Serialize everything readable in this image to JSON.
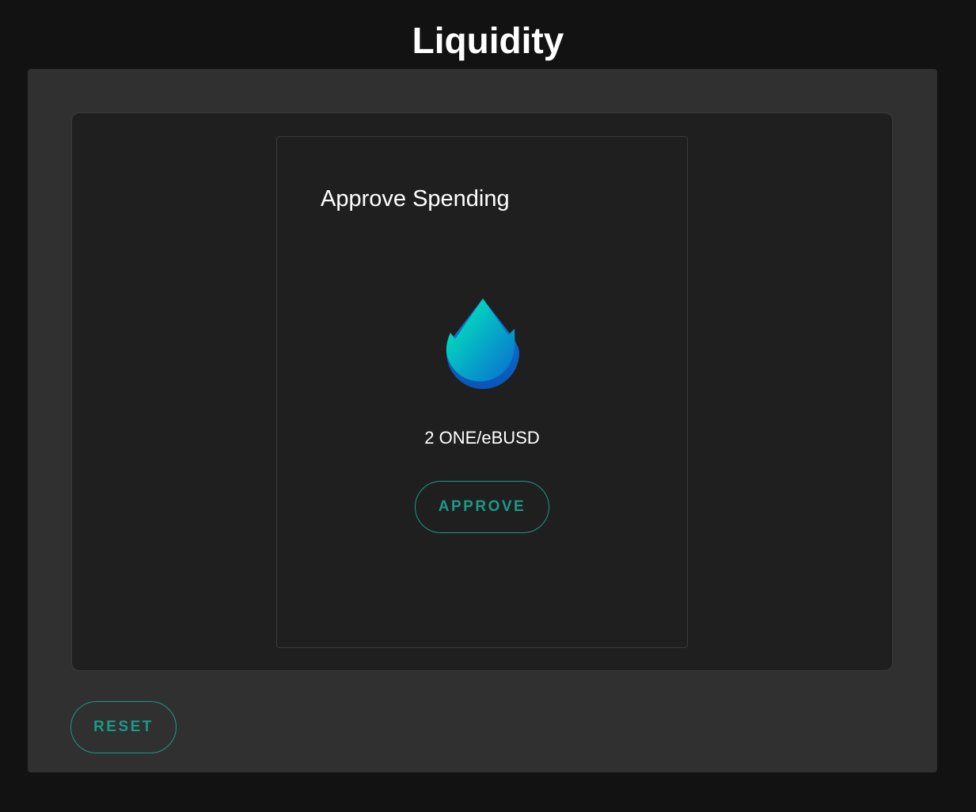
{
  "header": {
    "title": "Liquidity"
  },
  "approve_card": {
    "title": "Approve Spending",
    "token_icon": "water-drop-icon",
    "pair_label": "2 ONE/eBUSD",
    "approve_label": "APPROVE"
  },
  "footer": {
    "reset_label": "RESET"
  },
  "colors": {
    "background": "#121212",
    "panel": "#303030",
    "card": "#1f1f1f",
    "accent": "#1a9a86",
    "drop_gradient_start": "#00f5b8",
    "drop_gradient_end": "#0a6ad2"
  }
}
